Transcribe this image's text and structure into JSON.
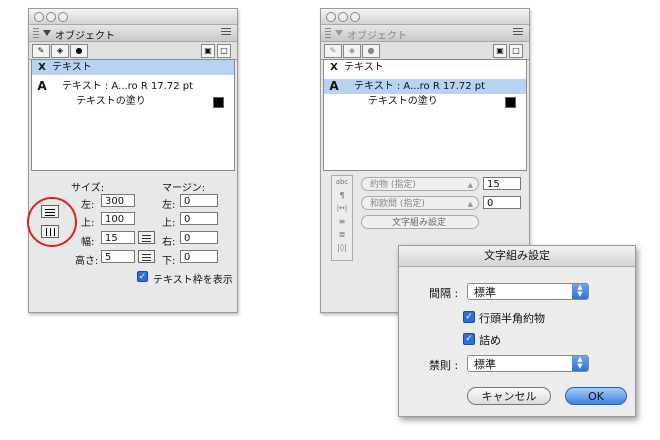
{
  "left_panel": {
    "title": "オブジェクト",
    "list": [
      {
        "icon": "X",
        "label": "テキスト"
      },
      {
        "icon": "A",
        "label": "テキスト : A...ro R 17.72 pt"
      },
      {
        "icon": "",
        "label": "テキストの塗り"
      }
    ],
    "size_label": "サイズ:",
    "margin_label": "マージン:",
    "size": [
      {
        "label": "左:",
        "value": "300"
      },
      {
        "label": "上:",
        "value": "100"
      },
      {
        "label": "幅:",
        "value": "15"
      },
      {
        "label": "高さ:",
        "value": "5"
      }
    ],
    "margin": [
      {
        "label": "左:",
        "value": "0"
      },
      {
        "label": "上:",
        "value": "0"
      },
      {
        "label": "右:",
        "value": "0"
      },
      {
        "label": "下:",
        "value": "0"
      }
    ],
    "show_frame_label": "テキスト枠を表示",
    "show_frame_checked": true
  },
  "right_panel": {
    "title": "オブジェクト",
    "list": [
      {
        "icon": "X",
        "label": "テキスト"
      },
      {
        "icon": "A",
        "label": "テキスト : A...ro R 17.72 pt"
      },
      {
        "icon": "",
        "label": "テキストの塗り"
      }
    ],
    "kerning_label": "約物 (指定)",
    "kerning_value": "15",
    "mixed_label": "和欧間 (指定)",
    "mixed_value": "0",
    "composition_button": "文字組み設定"
  },
  "dialog": {
    "title": "文字組み設定",
    "spacing_label": "間隔 :",
    "spacing_value": "標準",
    "option1_label": "行頭半角約物",
    "option1_checked": true,
    "option2_label": "詰め",
    "option2_checked": true,
    "kinsoku_label": "禁則 :",
    "kinsoku_value": "標準",
    "cancel_label": "キャンセル",
    "ok_label": "OK"
  },
  "colors": {
    "selection": "#b7d2f2",
    "accent": "#2e6fd8",
    "highlight_circle": "#e02020"
  }
}
